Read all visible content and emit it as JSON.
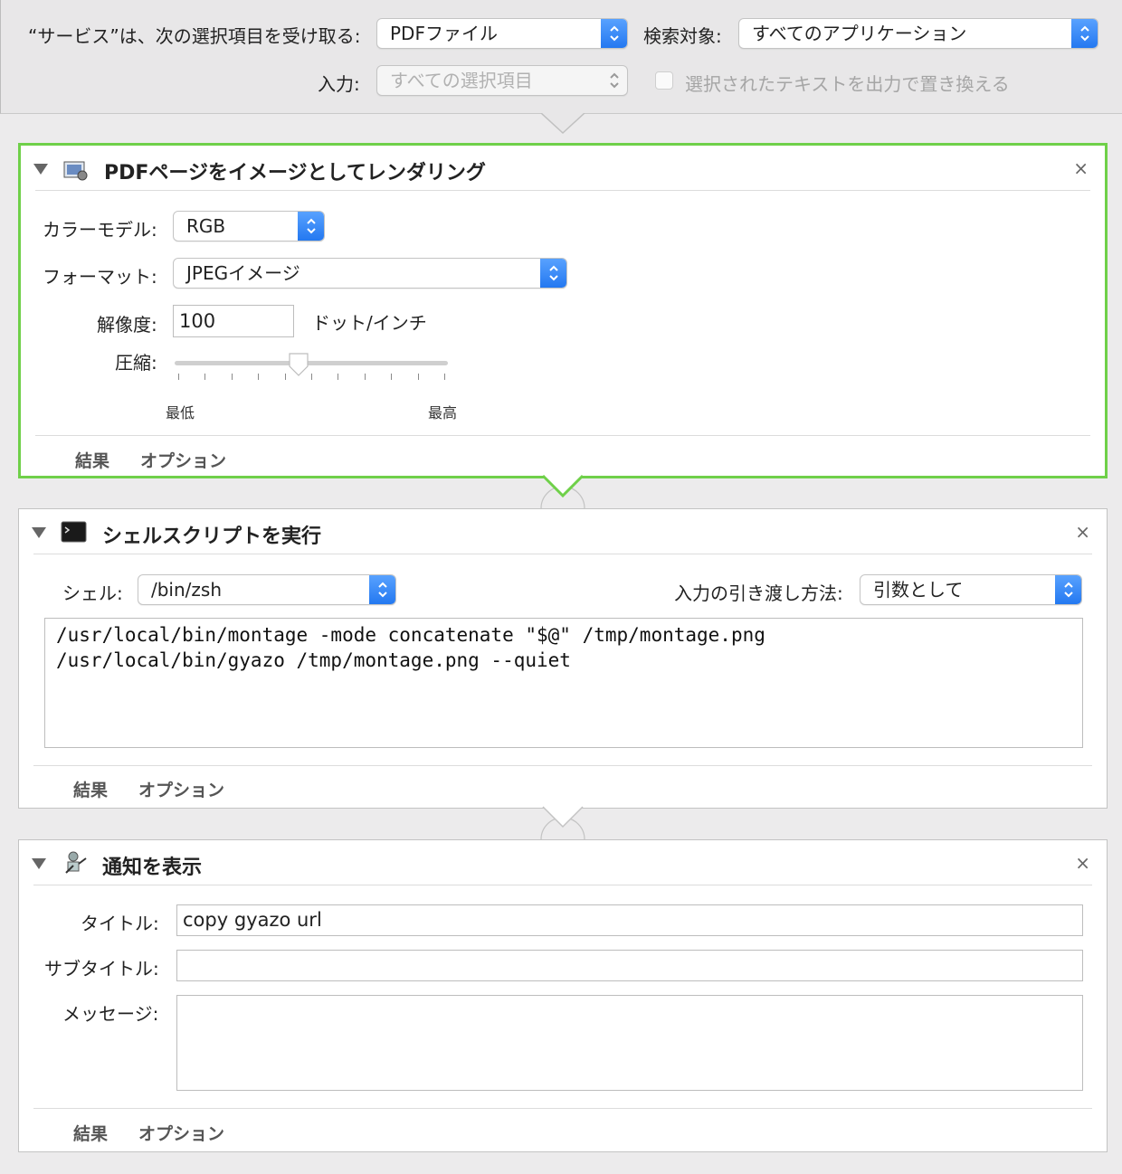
{
  "header": {
    "service_label": "“サービス”は、次の選択項目を受け取る:",
    "service_value": "PDFファイル",
    "search_label": "検索対象:",
    "search_value": "すべてのアプリケーション",
    "input_label": "入力:",
    "input_value": "すべての選択項目",
    "replace_label": "選択されたテキストを出力で置き換える"
  },
  "action1": {
    "title": "PDFページをイメージとしてレンダリング",
    "color_model_label": "カラーモデル:",
    "color_model_value": "RGB",
    "format_label": "フォーマット:",
    "format_value": "JPEGイメージ",
    "resolution_label": "解像度:",
    "resolution_value": "100",
    "resolution_unit": "ドット/インチ",
    "compression_label": "圧縮:",
    "compression_level": 0.45,
    "slider_min_label": "最低",
    "slider_max_label": "最高",
    "results_tab": "結果",
    "options_tab": "オプション"
  },
  "action2": {
    "title": "シェルスクリプトを実行",
    "shell_label": "シェル:",
    "shell_value": "/bin/zsh",
    "pass_input_label": "入力の引き渡し方法:",
    "pass_input_value": "引数として",
    "script_line1": "/usr/local/bin/montage -mode concatenate \"$@\" /tmp/montage.png",
    "script_line2": "/usr/local/bin/gyazo /tmp/montage.png --quiet",
    "results_tab": "結果",
    "options_tab": "オプション"
  },
  "action3": {
    "title": "通知を表示",
    "title_label": "タイトル:",
    "title_value": "copy gyazo url",
    "subtitle_label": "サブタイトル:",
    "subtitle_value": "",
    "message_label": "メッセージ:",
    "message_value": "",
    "results_tab": "結果",
    "options_tab": "オプション"
  },
  "colors": {
    "active_border": "#6fd049",
    "stepper_blue": "#2f84f5"
  },
  "icons": {
    "close": "×",
    "disclosure": "triangle-down"
  }
}
